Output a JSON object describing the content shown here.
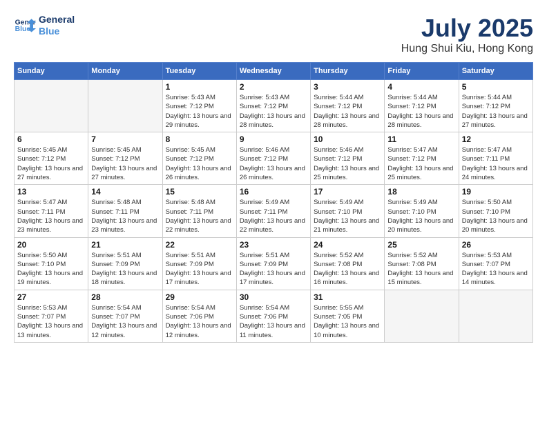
{
  "header": {
    "logo_line1": "General",
    "logo_line2": "Blue",
    "title": "July 2025",
    "subtitle": "Hung Shui Kiu, Hong Kong"
  },
  "calendar": {
    "weekdays": [
      "Sunday",
      "Monday",
      "Tuesday",
      "Wednesday",
      "Thursday",
      "Friday",
      "Saturday"
    ],
    "weeks": [
      [
        {
          "day": "",
          "info": ""
        },
        {
          "day": "",
          "info": ""
        },
        {
          "day": "1",
          "info": "Sunrise: 5:43 AM\nSunset: 7:12 PM\nDaylight: 13 hours and 29 minutes."
        },
        {
          "day": "2",
          "info": "Sunrise: 5:43 AM\nSunset: 7:12 PM\nDaylight: 13 hours and 28 minutes."
        },
        {
          "day": "3",
          "info": "Sunrise: 5:44 AM\nSunset: 7:12 PM\nDaylight: 13 hours and 28 minutes."
        },
        {
          "day": "4",
          "info": "Sunrise: 5:44 AM\nSunset: 7:12 PM\nDaylight: 13 hours and 28 minutes."
        },
        {
          "day": "5",
          "info": "Sunrise: 5:44 AM\nSunset: 7:12 PM\nDaylight: 13 hours and 27 minutes."
        }
      ],
      [
        {
          "day": "6",
          "info": "Sunrise: 5:45 AM\nSunset: 7:12 PM\nDaylight: 13 hours and 27 minutes."
        },
        {
          "day": "7",
          "info": "Sunrise: 5:45 AM\nSunset: 7:12 PM\nDaylight: 13 hours and 27 minutes."
        },
        {
          "day": "8",
          "info": "Sunrise: 5:45 AM\nSunset: 7:12 PM\nDaylight: 13 hours and 26 minutes."
        },
        {
          "day": "9",
          "info": "Sunrise: 5:46 AM\nSunset: 7:12 PM\nDaylight: 13 hours and 26 minutes."
        },
        {
          "day": "10",
          "info": "Sunrise: 5:46 AM\nSunset: 7:12 PM\nDaylight: 13 hours and 25 minutes."
        },
        {
          "day": "11",
          "info": "Sunrise: 5:47 AM\nSunset: 7:12 PM\nDaylight: 13 hours and 25 minutes."
        },
        {
          "day": "12",
          "info": "Sunrise: 5:47 AM\nSunset: 7:11 PM\nDaylight: 13 hours and 24 minutes."
        }
      ],
      [
        {
          "day": "13",
          "info": "Sunrise: 5:47 AM\nSunset: 7:11 PM\nDaylight: 13 hours and 23 minutes."
        },
        {
          "day": "14",
          "info": "Sunrise: 5:48 AM\nSunset: 7:11 PM\nDaylight: 13 hours and 23 minutes."
        },
        {
          "day": "15",
          "info": "Sunrise: 5:48 AM\nSunset: 7:11 PM\nDaylight: 13 hours and 22 minutes."
        },
        {
          "day": "16",
          "info": "Sunrise: 5:49 AM\nSunset: 7:11 PM\nDaylight: 13 hours and 22 minutes."
        },
        {
          "day": "17",
          "info": "Sunrise: 5:49 AM\nSunset: 7:10 PM\nDaylight: 13 hours and 21 minutes."
        },
        {
          "day": "18",
          "info": "Sunrise: 5:49 AM\nSunset: 7:10 PM\nDaylight: 13 hours and 20 minutes."
        },
        {
          "day": "19",
          "info": "Sunrise: 5:50 AM\nSunset: 7:10 PM\nDaylight: 13 hours and 20 minutes."
        }
      ],
      [
        {
          "day": "20",
          "info": "Sunrise: 5:50 AM\nSunset: 7:10 PM\nDaylight: 13 hours and 19 minutes."
        },
        {
          "day": "21",
          "info": "Sunrise: 5:51 AM\nSunset: 7:09 PM\nDaylight: 13 hours and 18 minutes."
        },
        {
          "day": "22",
          "info": "Sunrise: 5:51 AM\nSunset: 7:09 PM\nDaylight: 13 hours and 17 minutes."
        },
        {
          "day": "23",
          "info": "Sunrise: 5:51 AM\nSunset: 7:09 PM\nDaylight: 13 hours and 17 minutes."
        },
        {
          "day": "24",
          "info": "Sunrise: 5:52 AM\nSunset: 7:08 PM\nDaylight: 13 hours and 16 minutes."
        },
        {
          "day": "25",
          "info": "Sunrise: 5:52 AM\nSunset: 7:08 PM\nDaylight: 13 hours and 15 minutes."
        },
        {
          "day": "26",
          "info": "Sunrise: 5:53 AM\nSunset: 7:07 PM\nDaylight: 13 hours and 14 minutes."
        }
      ],
      [
        {
          "day": "27",
          "info": "Sunrise: 5:53 AM\nSunset: 7:07 PM\nDaylight: 13 hours and 13 minutes."
        },
        {
          "day": "28",
          "info": "Sunrise: 5:54 AM\nSunset: 7:07 PM\nDaylight: 13 hours and 12 minutes."
        },
        {
          "day": "29",
          "info": "Sunrise: 5:54 AM\nSunset: 7:06 PM\nDaylight: 13 hours and 12 minutes."
        },
        {
          "day": "30",
          "info": "Sunrise: 5:54 AM\nSunset: 7:06 PM\nDaylight: 13 hours and 11 minutes."
        },
        {
          "day": "31",
          "info": "Sunrise: 5:55 AM\nSunset: 7:05 PM\nDaylight: 13 hours and 10 minutes."
        },
        {
          "day": "",
          "info": ""
        },
        {
          "day": "",
          "info": ""
        }
      ]
    ]
  }
}
